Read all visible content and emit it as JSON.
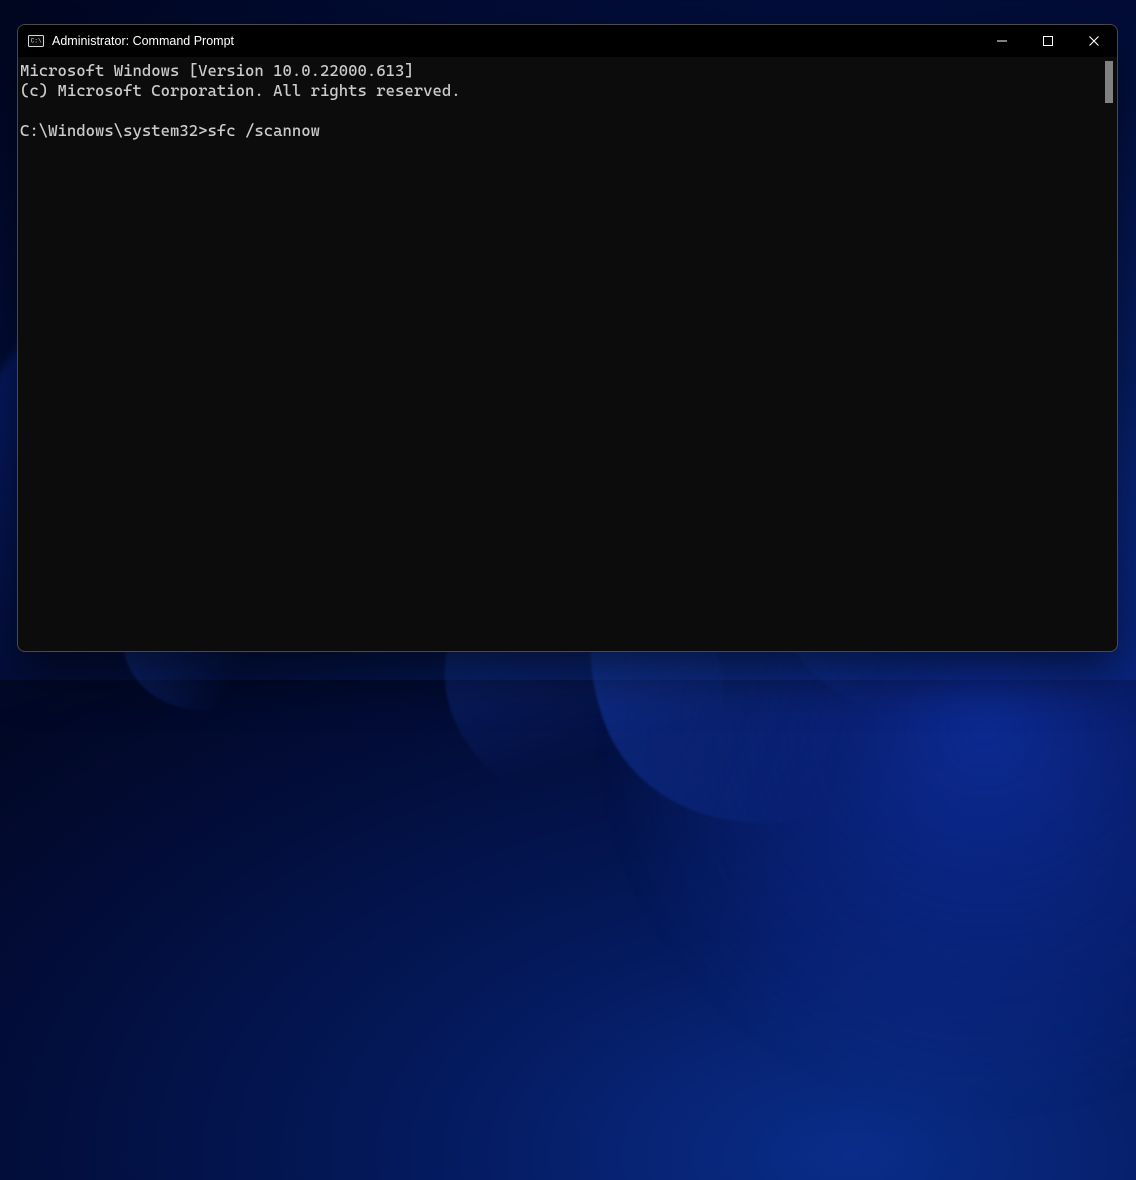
{
  "window": {
    "title": "Administrator: Command Prompt"
  },
  "terminal": {
    "line1": "Microsoft Windows [Version 10.0.22000.613]",
    "line2": "(c) Microsoft Corporation. All rights reserved.",
    "blank": "",
    "prompt": "C:\\Windows\\system32>",
    "command": "sfc /scannow"
  }
}
